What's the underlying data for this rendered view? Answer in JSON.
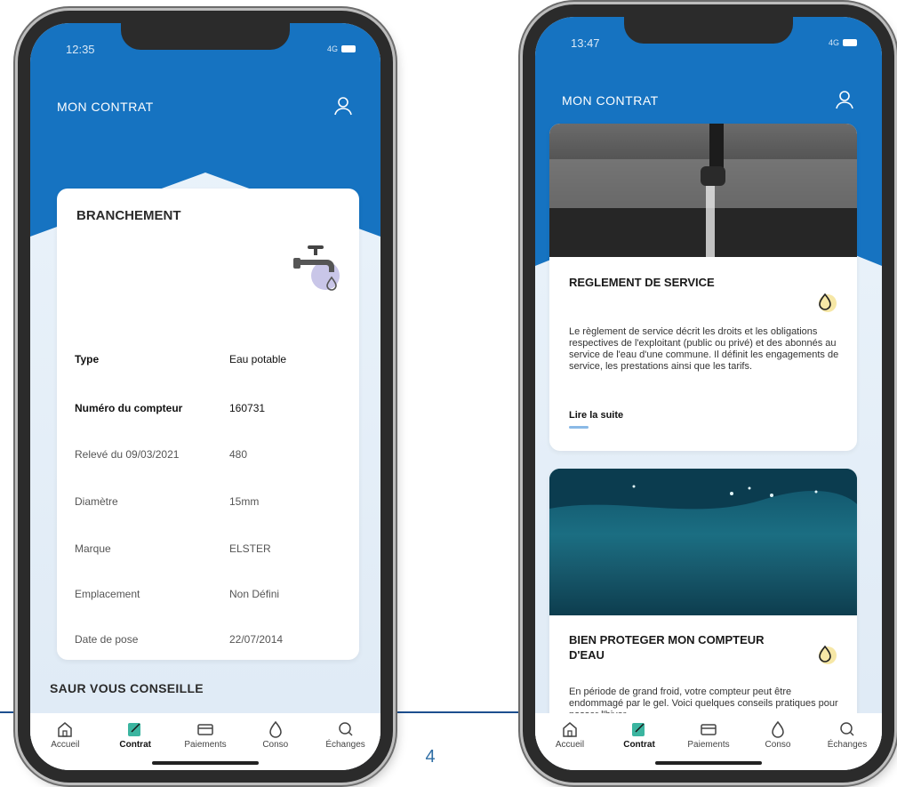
{
  "page_number": "4",
  "tabs": [
    {
      "label": "Accueil",
      "icon": "home-icon",
      "active": false
    },
    {
      "label": "Contrat",
      "icon": "contract-icon",
      "active": true
    },
    {
      "label": "Paiements",
      "icon": "card-icon",
      "active": false
    },
    {
      "label": "Conso",
      "icon": "drop-icon",
      "active": false
    },
    {
      "label": "Échanges",
      "icon": "chat-icon",
      "active": false
    }
  ],
  "colors": {
    "brand_blue": "#1673c1",
    "accent_green": "#3bb5a0",
    "page_number": "#2e6da4"
  },
  "left_phone": {
    "status_time": "12:35",
    "status_signal": "4G",
    "header_title": "MON CONTRAT",
    "card": {
      "title": "BRANCHEMENT",
      "rows": [
        {
          "label": "Type",
          "value": "Eau potable"
        },
        {
          "label": "Numéro du compteur",
          "value": "160731"
        },
        {
          "label": "Relevé du 09/03/2021",
          "value": "480"
        },
        {
          "label": "Diamètre",
          "value": "15mm"
        },
        {
          "label": "Marque",
          "value": "ELSTER"
        },
        {
          "label": "Emplacement",
          "value": "Non Défini"
        },
        {
          "label": "Date de pose",
          "value": "22/07/2014"
        }
      ]
    },
    "advice_title": "SAUR VOUS CONSEILLE"
  },
  "right_phone": {
    "status_time": "13:47",
    "status_signal": "4G",
    "header_title": "MON CONTRAT",
    "articles": [
      {
        "title": "REGLEMENT DE SERVICE",
        "text": "Le règlement de service décrit les droits et les obligations respectives de l'exploitant (public ou privé) et des abonnés au service de l'eau d'une commune. Il définit les engagements de service, les prestations ainsi que les tarifs.",
        "link": "Lire la suite"
      },
      {
        "title": "BIEN PROTEGER MON COMPTEUR D'EAU",
        "text": "En période de grand froid, votre compteur peut être endommagé par le gel. Voici quelques conseils pratiques pour passer l'hiver"
      }
    ]
  }
}
